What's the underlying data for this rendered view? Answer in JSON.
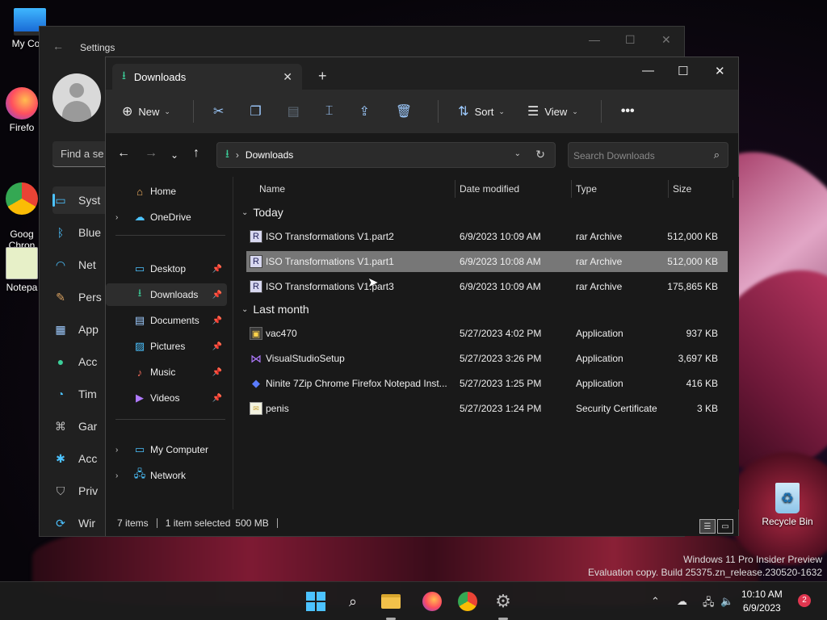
{
  "desktop": {
    "icons": [
      {
        "label": "My Com"
      },
      {
        "label": "Firefo"
      },
      {
        "label": "Goog\nChron"
      },
      {
        "label": "Notepa"
      },
      {
        "label": "Recycle Bin"
      }
    ],
    "watermark": {
      "line1": "Windows 11 Pro Insider Preview",
      "line2": "Evaluation copy. Build 25375.zn_release.230520-1632"
    }
  },
  "settings": {
    "title": "Settings",
    "search_placeholder": "Find a se",
    "nav": [
      {
        "label": "Syst",
        "icon": "monitor-icon"
      },
      {
        "label": "Blue",
        "icon": "bluetooth-icon"
      },
      {
        "label": "Net",
        "icon": "wifi-icon"
      },
      {
        "label": "Pers",
        "icon": "brush-icon"
      },
      {
        "label": "App",
        "icon": "apps-icon"
      },
      {
        "label": "Acc",
        "icon": "person-icon"
      },
      {
        "label": "Tim",
        "icon": "clock-globe-icon"
      },
      {
        "label": "Gar",
        "icon": "gamepad-icon"
      },
      {
        "label": "Acc",
        "icon": "accessibility-icon"
      },
      {
        "label": "Priv",
        "icon": "shield-icon"
      },
      {
        "label": "Wir",
        "icon": "update-icon"
      }
    ]
  },
  "explorer": {
    "tab_title": "Downloads",
    "toolbar": {
      "new_label": "New",
      "sort_label": "Sort",
      "view_label": "View"
    },
    "address": {
      "location": "Downloads"
    },
    "search_placeholder": "Search Downloads",
    "navpane": {
      "home": "Home",
      "onedrive": "OneDrive",
      "quick": [
        {
          "label": "Desktop",
          "icon": "desktop-folder-icon"
        },
        {
          "label": "Downloads",
          "icon": "download-icon"
        },
        {
          "label": "Documents",
          "icon": "documents-icon"
        },
        {
          "label": "Pictures",
          "icon": "pictures-icon"
        },
        {
          "label": "Music",
          "icon": "music-icon"
        },
        {
          "label": "Videos",
          "icon": "videos-icon"
        }
      ],
      "my_computer": "My Computer",
      "network": "Network"
    },
    "columns": {
      "name": "Name",
      "date": "Date modified",
      "type": "Type",
      "size": "Size"
    },
    "groups": [
      {
        "label": "Today",
        "files": [
          {
            "name": "ISO Transformations V1.part2",
            "date": "6/9/2023 10:09 AM",
            "type": "rar Archive",
            "size": "512,000 KB",
            "icon": "rar-icon"
          },
          {
            "name": "ISO Transformations V1.part1",
            "date": "6/9/2023 10:08 AM",
            "type": "rar Archive",
            "size": "512,000 KB",
            "icon": "rar-icon",
            "selected": true
          },
          {
            "name": "ISO Transformations V1.part3",
            "date": "6/9/2023 10:09 AM",
            "type": "rar Archive",
            "size": "175,865 KB",
            "icon": "rar-icon"
          }
        ]
      },
      {
        "label": "Last month",
        "files": [
          {
            "name": "vac470",
            "date": "5/27/2023 4:02 PM",
            "type": "Application",
            "size": "937 KB",
            "icon": "app-icon"
          },
          {
            "name": "VisualStudioSetup",
            "date": "5/27/2023 3:26 PM",
            "type": "Application",
            "size": "3,697 KB",
            "icon": "visual-studio-icon"
          },
          {
            "name": "Ninite 7Zip Chrome Firefox Notepad Inst...",
            "date": "5/27/2023 1:25 PM",
            "type": "Application",
            "size": "416 KB",
            "icon": "ninite-icon"
          },
          {
            "name": "penis",
            "date": "5/27/2023 1:24 PM",
            "type": "Security Certificate",
            "size": "3 KB",
            "icon": "certificate-icon"
          }
        ]
      }
    ],
    "status": {
      "items": "7 items",
      "selected": "1 item selected",
      "size": "500 MB"
    }
  },
  "taskbar": {
    "time": "10:10 AM",
    "date": "6/9/2023",
    "notifications": "2"
  },
  "colors": {
    "accent": "#4cc2ff",
    "selection": "#777777",
    "window_bg": "#191919",
    "toolbar_bg": "#2b2b2b"
  }
}
